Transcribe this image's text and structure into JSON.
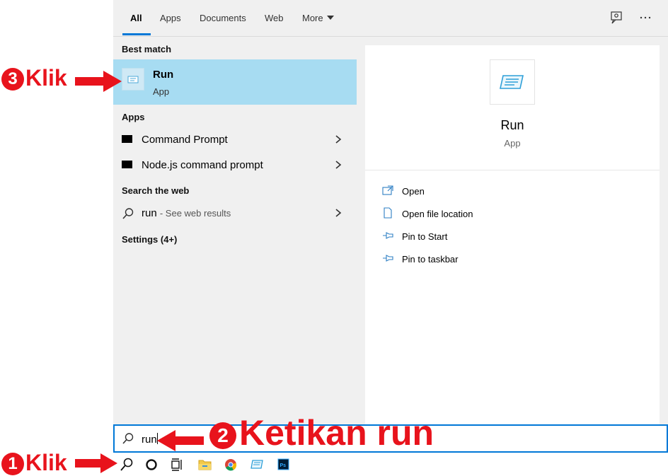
{
  "tabs": [
    {
      "label": "All",
      "active": true
    },
    {
      "label": "Apps"
    },
    {
      "label": "Documents"
    },
    {
      "label": "Web"
    },
    {
      "label": "More"
    }
  ],
  "top_icons": [
    "feedback-icon",
    "more-options-icon"
  ],
  "left": {
    "best_match_heading": "Best match",
    "best_match": {
      "title": "Run",
      "subtitle": "App",
      "icon": "run-app-icon"
    },
    "apps_heading": "Apps",
    "apps": [
      {
        "label": "Command Prompt",
        "icon": "command-prompt-icon"
      },
      {
        "label": "Node.js command prompt",
        "icon": "command-prompt-icon"
      }
    ],
    "web_heading": "Search the web",
    "web_result": {
      "query": "run",
      "suffix": "- See web results"
    },
    "settings_heading": "Settings (4+)"
  },
  "right": {
    "app_name": "Run",
    "app_type": "App",
    "actions": [
      {
        "label": "Open",
        "icon": "open-icon"
      },
      {
        "label": "Open file location",
        "icon": "file-location-icon"
      },
      {
        "label": "Pin to Start",
        "icon": "pin-icon"
      },
      {
        "label": "Pin to taskbar",
        "icon": "pin-icon"
      }
    ]
  },
  "search": {
    "value": "run"
  },
  "taskbar": [
    "search-icon",
    "cortana-icon",
    "task-view-icon",
    "file-explorer-icon",
    "chrome-icon",
    "run-icon",
    "photoshop-icon"
  ],
  "annotations": {
    "step1": {
      "num": "1",
      "text": "Klik"
    },
    "step2": {
      "num": "2",
      "text": "Ketikan run"
    },
    "step3": {
      "num": "3",
      "text": "Klik"
    }
  },
  "colors": {
    "accent": "#0078d7",
    "selection": "#a7dcf2",
    "annotation": "#e8131c"
  }
}
